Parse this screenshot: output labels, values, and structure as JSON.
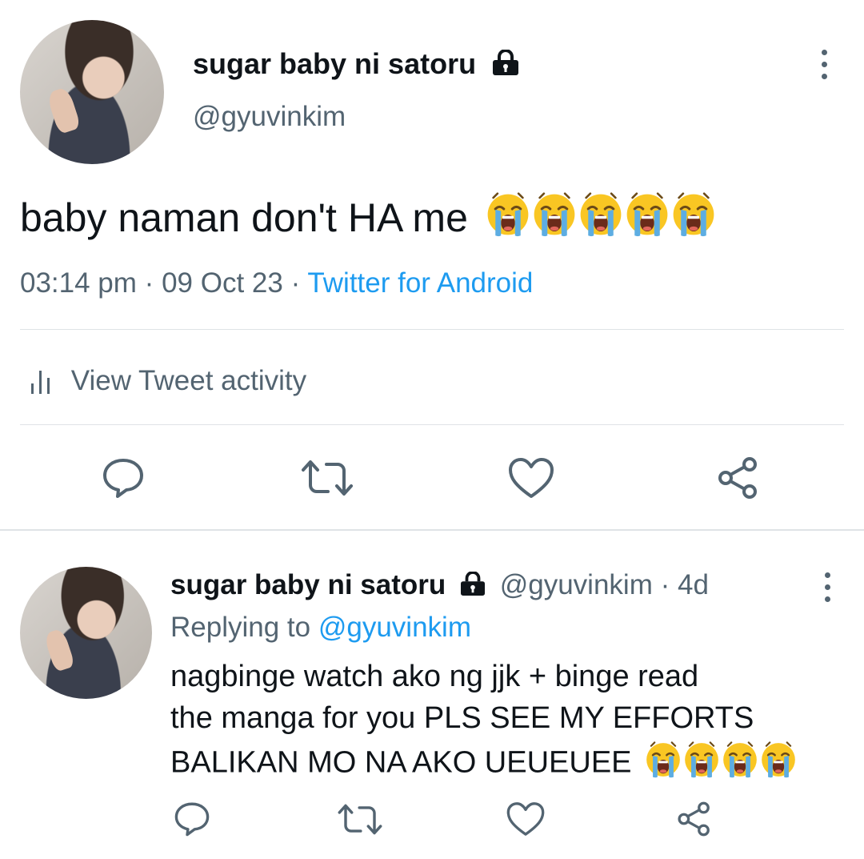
{
  "main_tweet": {
    "display_name": "sugar baby ni satoru",
    "handle": "@gyuvinkim",
    "text": "baby naman don't HA me",
    "emoji_name": "loudly-crying-face",
    "emoji_count": 5,
    "time": "03:14 pm",
    "separator": "·",
    "date": "09 Oct 23",
    "source": "Twitter for Android",
    "activity_label": "View Tweet activity"
  },
  "reply_tweet": {
    "display_name": "sugar baby ni satoru",
    "handle": "@gyuvinkim",
    "separator": "·",
    "age": "4d",
    "replying_prefix": "Replying to",
    "replying_handle": "@gyuvinkim",
    "text_line1": "nagbinge watch ako ng jjk + binge read",
    "text_line2": "the manga for you PLS SEE MY EFFORTS",
    "text_line3": "BALIKAN MO NA AKO UEUEUEE",
    "emoji_name": "loudly-crying-face",
    "emoji_count": 4
  },
  "actions": [
    "reply",
    "retweet",
    "like",
    "share"
  ],
  "colors": {
    "text": "#0f1419",
    "muted": "#536471",
    "link": "#1d9bf0",
    "divider": "#dfe3e6"
  }
}
